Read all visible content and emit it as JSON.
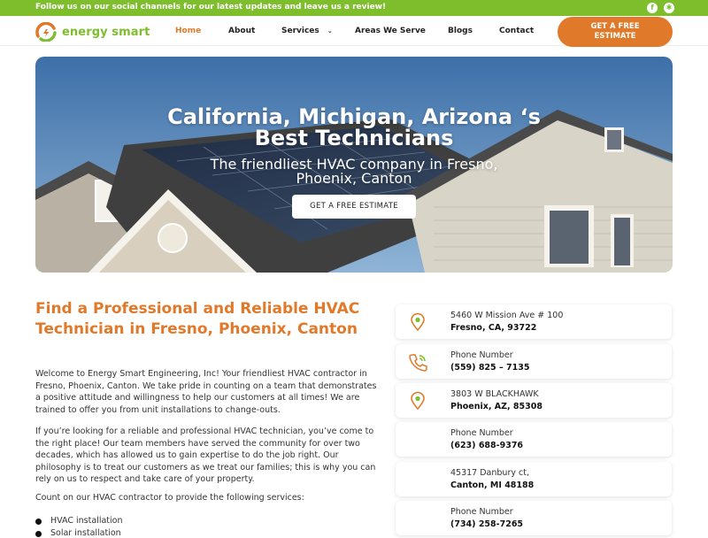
{
  "topbar": {
    "text": "Follow us on our social channels for our latest updates and leave us a review!",
    "social_icons": [
      "facebook-icon",
      "yelp-icon"
    ]
  },
  "header": {
    "logo_text": "energy smart",
    "nav": [
      {
        "label": "Home",
        "active": true
      },
      {
        "label": "About",
        "active": false
      },
      {
        "label": "Services",
        "active": false,
        "dropdown": true
      },
      {
        "label": "Areas We Serve",
        "active": false
      },
      {
        "label": "Blogs",
        "active": false
      },
      {
        "label": "Contact",
        "active": false
      }
    ],
    "cta_line1": "GET A FREE",
    "cta_line2": "ESTIMATE"
  },
  "hero": {
    "title_line1": "California, Michigan, Arizona ‘s",
    "title_line2": "Best Technicians",
    "subtitle_line1": "The friendliest HVAC company in Fresno,",
    "subtitle_line2": "Phoenix, Canton",
    "button": "GET A FREE ESTIMATE"
  },
  "content": {
    "title": "Find a Professional and Reliable HVAC Technician in Fresno, Phoenix, Canton",
    "paragraphs": [
      "Welcome to Energy Smart Engineering, Inc! Your friendliest HVAC contractor in Fresno, Phoenix, Canton. We take pride in counting on a team that demonstrates a positive attitude and willingness to help our customers at all times! We are trained to offer you from unit installations to change-outs.",
      "If you’re looking for a reliable and professional HVAC technician, you’ve come to the right place! Our team members have served the community for over two decades, which has allowed us to gain expertise to do the job right. Our philosophy is to treat our customers as we treat our families; this is why you can rely on us to respect and take care of your property.",
      "Count on our HVAC contractor to provide the following services:"
    ],
    "services": [
      "HVAC installation",
      "Solar installation"
    ]
  },
  "contacts": [
    {
      "type": "location",
      "icon": "map-pin-icon",
      "line1": "5460 W Mission Ave # 100",
      "line2": "Fresno, CA, 93722"
    },
    {
      "type": "phone",
      "icon": "phone-icon",
      "line1": "Phone Number",
      "line2": "(559) 825 – 7135"
    },
    {
      "type": "location",
      "icon": "map-pin-icon",
      "line1": "3803 W BLACKHAWK",
      "line2": "Phoenix, AZ, 85308"
    },
    {
      "type": "phone",
      "icon": "phone-icon",
      "line1": "Phone Number",
      "line2": "(623) 688-9376"
    },
    {
      "type": "location",
      "icon": "map-pin-icon",
      "line1": "45317 Danbury ct,",
      "line2": "Canton, MI 48188"
    },
    {
      "type": "phone",
      "icon": "phone-icon",
      "line1": "Phone Number",
      "line2": "(734) 258-7265"
    }
  ],
  "colors": {
    "green": "#7ebd2c",
    "orange": "#e0792a"
  }
}
